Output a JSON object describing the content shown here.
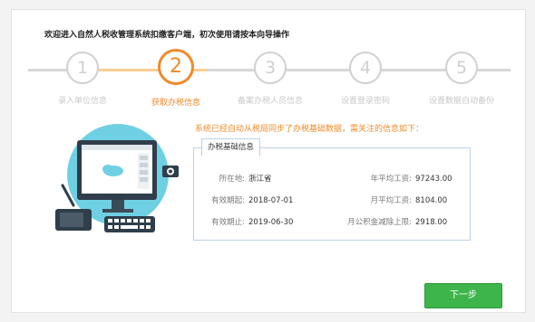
{
  "title": "欢迎进入自然人税收管理系统扣缴客户端，初次使用请按本向导操作",
  "steps": [
    {
      "num": "1",
      "label": "录入单位信息"
    },
    {
      "num": "2",
      "label": "获取办税信息"
    },
    {
      "num": "3",
      "label": "备案办税人员信息"
    },
    {
      "num": "4",
      "label": "设置登录密码"
    },
    {
      "num": "5",
      "label": "设置数据自动备份"
    }
  ],
  "active_step": 2,
  "notice": "系统已经自动从税局同步了办税基础数据，需关注的信息如下：",
  "info": {
    "tab": "办税基础信息",
    "left": [
      {
        "k": "所在地:",
        "v": "浙江省"
      },
      {
        "k": "有效期起:",
        "v": "2018-07-01"
      },
      {
        "k": "有效期止:",
        "v": "2019-06-30"
      }
    ],
    "right": [
      {
        "k": "年平均工资:",
        "v": "97243.00"
      },
      {
        "k": "月平均工资:",
        "v": "8104.00"
      },
      {
        "k": "月公积金减除上限:",
        "v": "2918.00"
      }
    ]
  },
  "next_label": "下一步",
  "colors": {
    "accent": "#f18a2a",
    "button": "#3db54a",
    "border": "#bcd1e6"
  }
}
